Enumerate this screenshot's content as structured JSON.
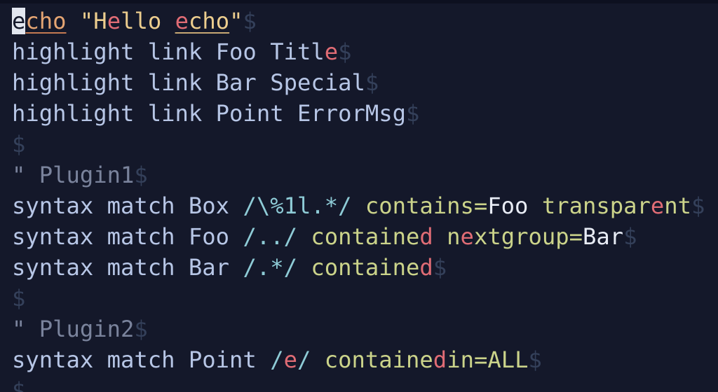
{
  "colors": {
    "background": "#14182a",
    "plain": "#b7c6e6",
    "string": "#eccd8e",
    "statement": "#e5a573",
    "match": "#e06c75",
    "eol": "#34405a",
    "comment": "#7a839c",
    "regex": "#8ecbd6",
    "keyword": "#cbd38a",
    "white": "#e8ecf5",
    "cursor_bg": "#e2e6ef",
    "cursor_fg": "#14182a",
    "echo_underline": "#c47a52",
    "hello_underline": "#c8a874"
  },
  "lines": [
    [
      {
        "t": "e",
        "c": "cursor",
        "name": "cursor"
      },
      {
        "t": "cho",
        "c": "statement",
        "ul": "echo_underline"
      },
      {
        "t": " "
      },
      {
        "t": "\"H",
        "c": "string"
      },
      {
        "t": "e",
        "c": "match"
      },
      {
        "t": "llo ",
        "c": "string"
      },
      {
        "t": "e",
        "c": "match",
        "ul": "hello_underline"
      },
      {
        "t": "cho",
        "c": "string",
        "ul": "hello_underline"
      },
      {
        "t": "\"",
        "c": "string"
      },
      {
        "t": "$",
        "c": "eol",
        "name": "eol-marker"
      }
    ],
    [
      {
        "t": "highlight link Foo Titl"
      },
      {
        "t": "e",
        "c": "match"
      },
      {
        "t": "$",
        "c": "eol",
        "name": "eol-marker"
      }
    ],
    [
      {
        "t": "highlight link Bar Special"
      },
      {
        "t": "$",
        "c": "eol",
        "name": "eol-marker"
      }
    ],
    [
      {
        "t": "highlight link Point ErrorMsg"
      },
      {
        "t": "$",
        "c": "eol",
        "name": "eol-marker"
      }
    ],
    [
      {
        "t": "$",
        "c": "eol",
        "name": "eol-marker"
      }
    ],
    [
      {
        "t": "\" Plugin1",
        "c": "comment"
      },
      {
        "t": "$",
        "c": "eol",
        "name": "eol-marker"
      }
    ],
    [
      {
        "t": "syntax match Box "
      },
      {
        "t": "/\\%1l.*/",
        "c": "regex"
      },
      {
        "t": " "
      },
      {
        "t": "contains=",
        "c": "keyword"
      },
      {
        "t": "Foo",
        "c": "white"
      },
      {
        "t": " "
      },
      {
        "t": "transpar",
        "c": "keyword"
      },
      {
        "t": "e",
        "c": "match"
      },
      {
        "t": "nt",
        "c": "keyword"
      },
      {
        "t": "$",
        "c": "eol",
        "name": "eol-marker"
      }
    ],
    [
      {
        "t": "syntax match Foo "
      },
      {
        "t": "/../",
        "c": "regex"
      },
      {
        "t": " "
      },
      {
        "t": "containe",
        "c": "keyword"
      },
      {
        "t": "d",
        "c": "match"
      },
      {
        "t": " "
      },
      {
        "t": "n",
        "c": "keyword"
      },
      {
        "t": "e",
        "c": "match"
      },
      {
        "t": "xtgroup=",
        "c": "keyword"
      },
      {
        "t": "Bar",
        "c": "white"
      },
      {
        "t": "$",
        "c": "eol",
        "name": "eol-marker"
      }
    ],
    [
      {
        "t": "syntax match Bar "
      },
      {
        "t": "/.*/",
        "c": "regex"
      },
      {
        "t": " "
      },
      {
        "t": "containe",
        "c": "keyword"
      },
      {
        "t": "d",
        "c": "match"
      },
      {
        "t": "$",
        "c": "eol",
        "name": "eol-marker"
      }
    ],
    [
      {
        "t": "$",
        "c": "eol",
        "name": "eol-marker"
      }
    ],
    [
      {
        "t": "\" Plugin2",
        "c": "comment"
      },
      {
        "t": "$",
        "c": "eol",
        "name": "eol-marker"
      }
    ],
    [
      {
        "t": "syntax match Point "
      },
      {
        "t": "/",
        "c": "regex"
      },
      {
        "t": "e",
        "c": "match"
      },
      {
        "t": "/",
        "c": "regex"
      },
      {
        "t": " "
      },
      {
        "t": "containe",
        "c": "keyword"
      },
      {
        "t": "d",
        "c": "match"
      },
      {
        "t": "in=ALL",
        "c": "keyword"
      },
      {
        "t": "$",
        "c": "eol",
        "name": "eol-marker"
      }
    ],
    [
      {
        "t": "$",
        "c": "eol",
        "name": "eol-marker"
      }
    ]
  ]
}
